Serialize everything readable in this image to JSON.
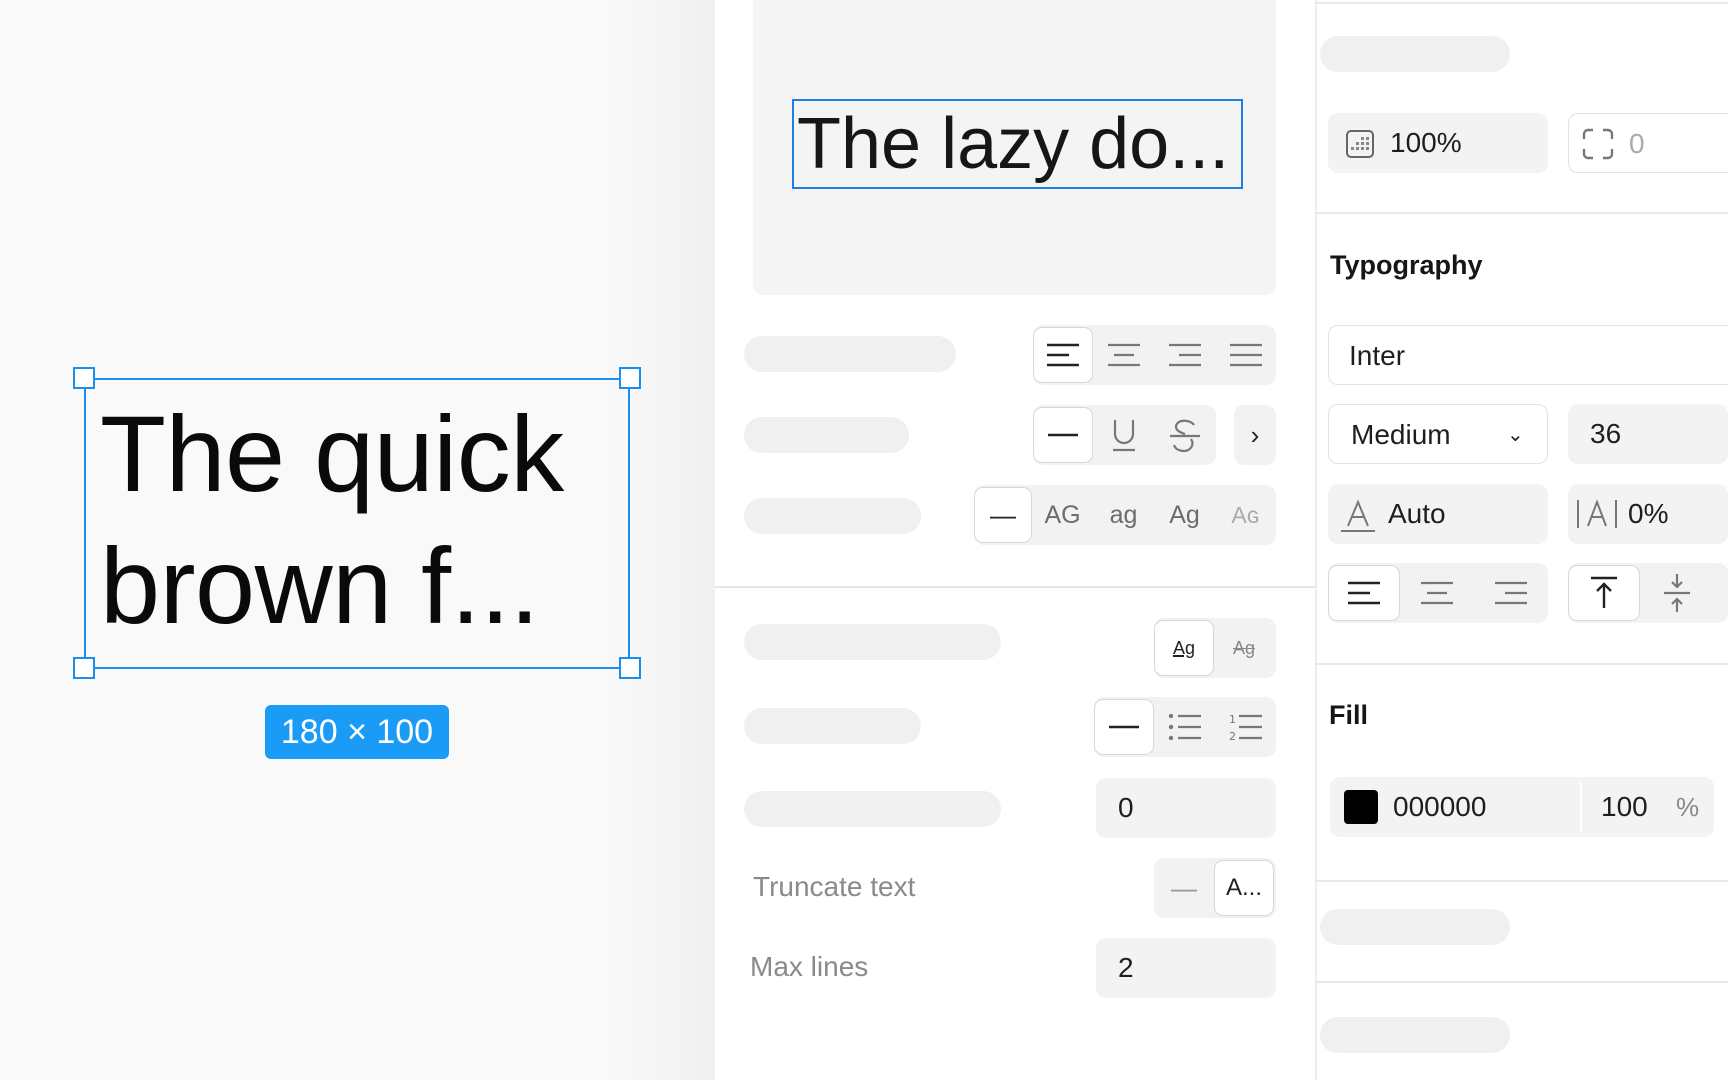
{
  "canvas": {
    "text_content": "The quick brown f...",
    "line1": "The quick",
    "line2": "brown f...",
    "size_badge": "180 × 100"
  },
  "preview": {
    "text": "The lazy do..."
  },
  "text_panel": {
    "align_icons": [
      "align-left-icon",
      "align-center-icon",
      "align-right-icon",
      "align-justify-icon"
    ],
    "decoration_icons": [
      "no-decoration-icon",
      "underline-icon",
      "strikethrough-icon"
    ],
    "case_options": [
      "—",
      "AG",
      "ag",
      "Ag",
      "Aɢ"
    ],
    "vertical_trim_labels": [
      "Ag",
      "Ag"
    ],
    "paragraph_spacing": "0",
    "truncate_label": "Truncate text",
    "truncate_options": [
      "—",
      "A..."
    ],
    "max_lines_label": "Max lines",
    "max_lines_value": "2"
  },
  "right_panel": {
    "opacity_value": "100%",
    "corner_value": "0",
    "typography_title": "Typography",
    "font_family": "Inter",
    "font_weight": "Medium",
    "font_size": "36",
    "line_height": "Auto",
    "letter_spacing": "0%",
    "fill_title": "Fill",
    "fill_hex": "000000",
    "fill_opacity": "100",
    "fill_percent": "%"
  },
  "colors": {
    "selection": "#1a8ff0",
    "badge": "#1a9bf5",
    "fill_swatch": "#000000"
  }
}
